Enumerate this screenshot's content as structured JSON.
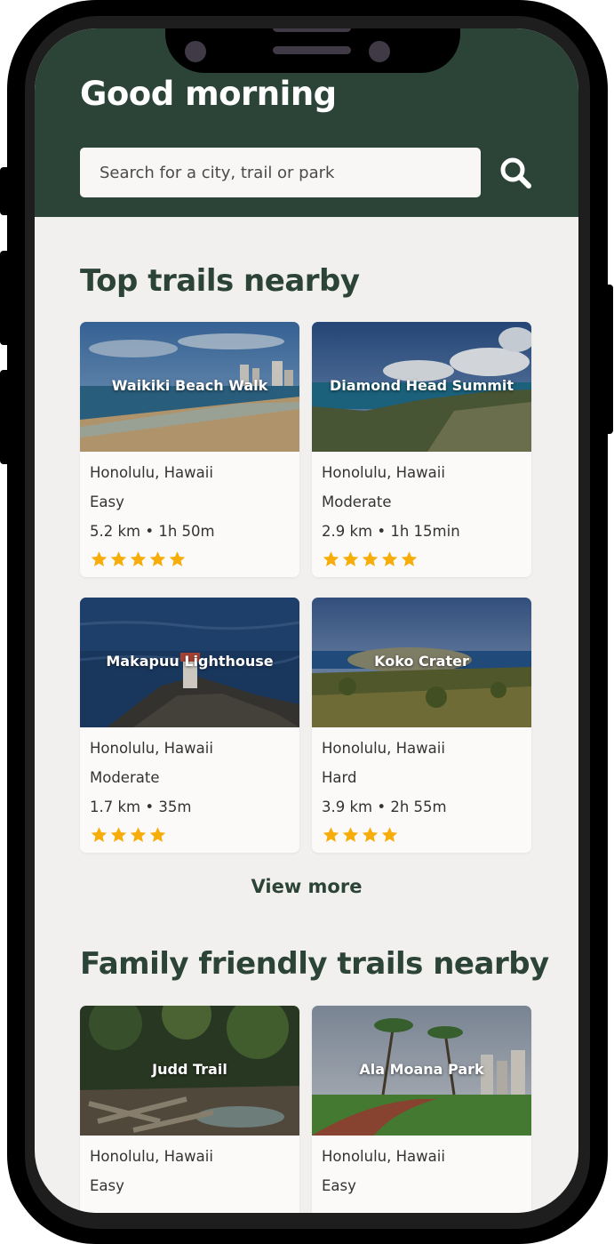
{
  "header": {
    "greeting": "Good morning",
    "search_placeholder": "Search for a city, trail or park",
    "search_icon": "magnifier-icon"
  },
  "colors": {
    "brand_green": "#2c4437",
    "background": "#f2f0ee",
    "card_background": "#fbfaf9",
    "star": "#f6ad09"
  },
  "top_trails": {
    "title": "Top trails nearby",
    "cards": [
      {
        "name": "Waikiki Beach Walk",
        "location": "Honolulu, Hawaii",
        "difficulty": "Easy",
        "stats": "5.2 km • 1h 50m",
        "rating": 5
      },
      {
        "name": "Diamond Head Summit",
        "location": "Honolulu, Hawaii",
        "difficulty": "Moderate",
        "stats": "2.9 km • 1h 15min",
        "rating": 5
      },
      {
        "name": "Makapuu Lighthouse",
        "location": "Honolulu, Hawaii",
        "difficulty": "Moderate",
        "stats": "1.7 km • 35m",
        "rating": 4
      },
      {
        "name": "Koko Crater",
        "location": "Honolulu, Hawaii",
        "difficulty": "Hard",
        "stats": "3.9 km • 2h 55m",
        "rating": 4
      }
    ],
    "view_more_label": "View more"
  },
  "family_trails": {
    "title": "Family friendly trails nearby",
    "cards": [
      {
        "name": "Judd Trail",
        "location": "Honolulu, Hawaii",
        "difficulty": "Easy"
      },
      {
        "name": "Ala Moana Park",
        "location": "Honolulu, Hawaii",
        "difficulty": "Easy"
      }
    ]
  }
}
